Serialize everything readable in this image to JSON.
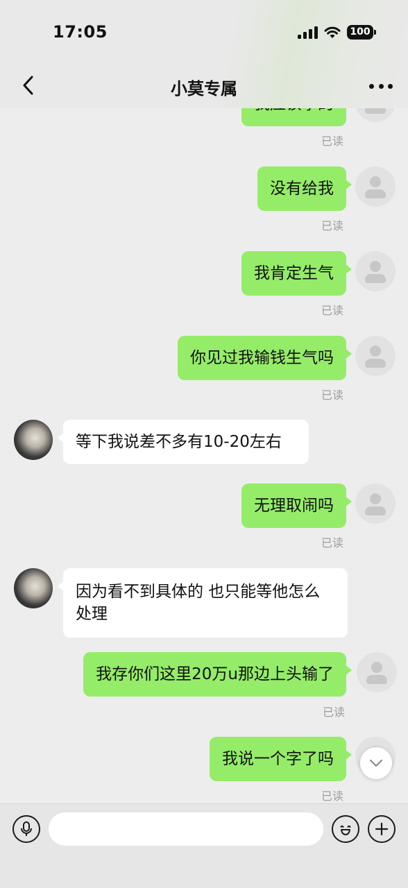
{
  "status_bar": {
    "time": "17:05",
    "battery": "100"
  },
  "header": {
    "title": "小莫专属"
  },
  "read_label": "已读",
  "messages": [
    {
      "side": "right",
      "text": "我应该拿的"
    },
    {
      "side": "right",
      "text": "没有给我"
    },
    {
      "side": "right",
      "text": "我肯定生气"
    },
    {
      "side": "right",
      "text": "你见过我输钱生气吗"
    },
    {
      "side": "left",
      "text": "等下我说差不多有10-20左右"
    },
    {
      "side": "right",
      "text": "无理取闹吗"
    },
    {
      "side": "left",
      "text": "因为看不到具体的 也只能等他怎么处理"
    },
    {
      "side": "right",
      "text": "我存你们这里20万u那边上头输了"
    },
    {
      "side": "right",
      "text": "我说一个字了吗"
    }
  ],
  "input": {
    "placeholder": ""
  },
  "colors": {
    "my_bubble": "#95ec69",
    "their_bubble": "#ffffff",
    "background": "#ededed"
  },
  "icons": [
    "back-icon",
    "more-icon",
    "voice-icon",
    "emoji-icon",
    "plus-icon",
    "chevron-down-icon",
    "avatar-placeholder-icon"
  ]
}
